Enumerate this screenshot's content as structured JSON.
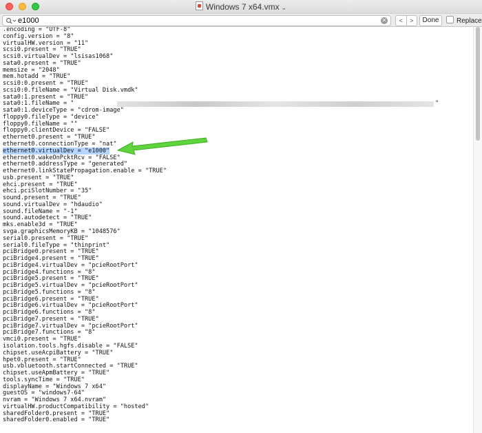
{
  "window": {
    "title": "Windows 7 x64.vmx",
    "close_label": "close",
    "minimize_label": "minimize",
    "zoom_label": "zoom"
  },
  "findbar": {
    "search_value": "e1000",
    "prev_label": "<",
    "next_label": ">",
    "done_label": "Done",
    "replace_label": "Replace"
  },
  "editor": {
    "selected_line_index": 20,
    "redacted_line_index": 15,
    "lines": [
      {
        "text": ".encoding = \"UTF-8\""
      },
      {
        "text": "config.version = \"8\""
      },
      {
        "text": "virtualHW.version = \"11\""
      },
      {
        "text": "scsi0.present = \"TRUE\""
      },
      {
        "text": "scsi0.virtualDev = \"lsisas1068\""
      },
      {
        "text": "sata0.present = \"TRUE\""
      },
      {
        "text": "memsize = \"2048\""
      },
      {
        "text": "mem.hotadd = \"TRUE\""
      },
      {
        "text": "scsi0:0.present = \"TRUE\""
      },
      {
        "text": "scsi0:0.fileName = \"Virtual Disk.vmdk\""
      },
      {
        "text": "sata0:1.present = \"TRUE\""
      },
      {
        "text": "sata0:1.fileName = \""
      },
      {
        "text": "sata0:1.deviceType = \"cdrom-image\""
      },
      {
        "text": "floppy0.fileType = \"device\""
      },
      {
        "text": "floppy0.fileName = \"\""
      },
      {
        "text": "floppy0.clientDevice = \"FALSE\""
      },
      {
        "text": "ethernet0.present = \"TRUE\""
      },
      {
        "text": "ethernet0.connectionType = \"nat\""
      },
      {
        "text": "ethernet0.virtualDev = \"e1000\""
      },
      {
        "text": "ethernet0.wakeOnPcktRcv = \"FALSE\""
      },
      {
        "text": "ethernet0.addressType = \"generated\""
      },
      {
        "text": "ethernet0.linkStatePropagation.enable = \"TRUE\""
      },
      {
        "text": "usb.present = \"TRUE\""
      },
      {
        "text": "ehci.present = \"TRUE\""
      },
      {
        "text": "ehci.pciSlotNumber = \"35\""
      },
      {
        "text": "sound.present = \"TRUE\""
      },
      {
        "text": "sound.virtualDev = \"hdaudio\""
      },
      {
        "text": "sound.fileName = \"-1\""
      },
      {
        "text": "sound.autodetect = \"TRUE\""
      },
      {
        "text": "mks.enable3d = \"TRUE\""
      },
      {
        "text": "svga.graphicsMemoryKB = \"1048576\""
      },
      {
        "text": "serial0.present = \"TRUE\""
      },
      {
        "text": "serial0.fileType = \"thinprint\""
      },
      {
        "text": "pciBridge0.present = \"TRUE\""
      },
      {
        "text": "pciBridge4.present = \"TRUE\""
      },
      {
        "text": "pciBridge4.virtualDev = \"pcieRootPort\""
      },
      {
        "text": "pciBridge4.functions = \"8\""
      },
      {
        "text": "pciBridge5.present = \"TRUE\""
      },
      {
        "text": "pciBridge5.virtualDev = \"pcieRootPort\""
      },
      {
        "text": "pciBridge5.functions = \"8\""
      },
      {
        "text": "pciBridge6.present = \"TRUE\""
      },
      {
        "text": "pciBridge6.virtualDev = \"pcieRootPort\""
      },
      {
        "text": "pciBridge6.functions = \"8\""
      },
      {
        "text": "pciBridge7.present = \"TRUE\""
      },
      {
        "text": "pciBridge7.virtualDev = \"pcieRootPort\""
      },
      {
        "text": "pciBridge7.functions = \"8\""
      },
      {
        "text": "vmci0.present = \"TRUE\""
      },
      {
        "text": "isolation.tools.hgfs.disable = \"FALSE\""
      },
      {
        "text": "chipset.useAcpiBattery = \"TRUE\""
      },
      {
        "text": "hpet0.present = \"TRUE\""
      },
      {
        "text": "usb.vbluetooth.startConnected = \"TRUE\""
      },
      {
        "text": "chipset.useApmBattery = \"TRUE\""
      },
      {
        "text": "tools.syncTime = \"TRUE\""
      },
      {
        "text": "displayName = \"Windows 7 x64\""
      },
      {
        "text": "guestOS = \"windows7-64\""
      },
      {
        "text": "nvram = \"Windows 7 x64.nvram\""
      },
      {
        "text": "virtualHW.productCompatibility = \"hosted\""
      },
      {
        "text": "sharedFolder0.present = \"TRUE\""
      },
      {
        "text": "sharedFolder0.enabled = \"TRUE\""
      }
    ]
  },
  "colors": {
    "selection": "#b4d5fe",
    "annotation_arrow": "#5fd43c",
    "spellcheck": "#e0453b"
  },
  "icons": {
    "search": "magnifier-icon",
    "clear": "clear-search-icon",
    "document": "document-icon",
    "arrow": "annotation-arrow-icon"
  }
}
